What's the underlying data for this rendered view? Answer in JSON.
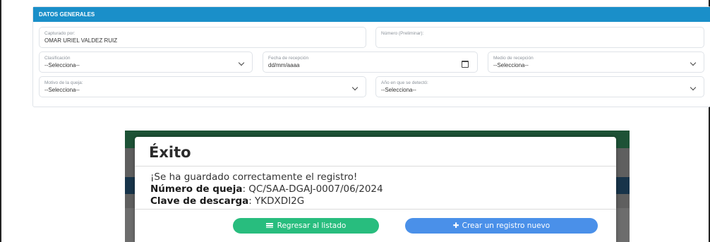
{
  "panel": {
    "title": "DATOS GENERALES",
    "fields": {
      "capturado_por": {
        "label": "Capturado por:",
        "value": "OMAR URIEL VALDEZ RUIZ"
      },
      "numero": {
        "label": "Número (Preliminar):",
        "value": ""
      },
      "clasificacion": {
        "label": "Clasificación",
        "value": "--Selecciona--"
      },
      "fecha": {
        "label": "Fecha de recepción",
        "value": "dd/mm/aaaa"
      },
      "medio": {
        "label": "Medio de recepción",
        "value": "--Selecciona--"
      },
      "motivo": {
        "label": "Motivo de la queja:",
        "value": "--Selecciona--"
      },
      "anio": {
        "label": "Año en que se detectó:",
        "value": "--Selecciona--"
      }
    }
  },
  "modal": {
    "title": "Éxito",
    "message": "¡Se ha guardado correctamente el registro!",
    "queja_label": "Número de queja",
    "queja_value": ": QC/SAA-DGAJ-0007/06/2024",
    "clave_label": "Clave de descarga",
    "clave_value": ": YKDXDI2G",
    "back_button": "Regresar al listado",
    "new_button": "Crear un registro nuevo"
  },
  "icons": {
    "list": "list-icon",
    "plus": "plus-icon",
    "calendar": "calendar-icon",
    "chevron": "chevron-down-icon"
  },
  "colors": {
    "header": "#1a8fc9",
    "green_button": "#28bd7e",
    "blue_button": "#4a90e9"
  }
}
